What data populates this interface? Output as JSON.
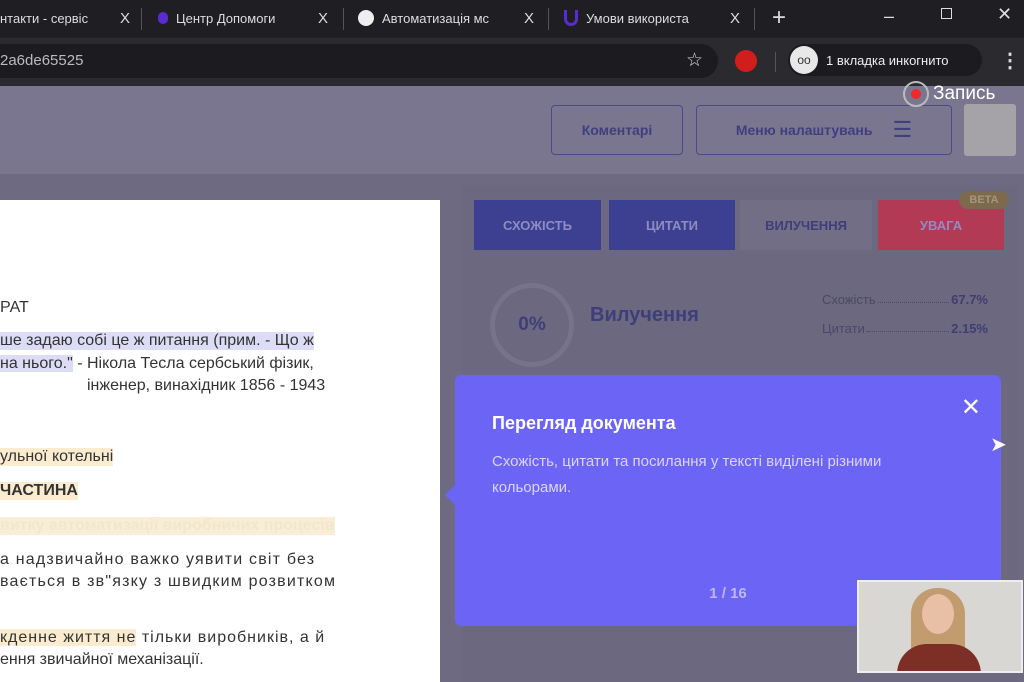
{
  "browser": {
    "tabs": [
      {
        "label": "нтакти - сервіс",
        "icon": "page-icon"
      },
      {
        "label": "Центр Допомоги",
        "icon": "unicheck-icon"
      },
      {
        "label": "Автоматизація мс",
        "icon": "globe-icon"
      },
      {
        "label": "Умови використа",
        "icon": "unicheck-icon"
      }
    ],
    "close_glyph": "X",
    "new_tab": "+",
    "url": "2a6de65525",
    "incognito_label": "1 вкладка инкогнито",
    "incognito_icon": "oo",
    "recording": "Запись"
  },
  "header": {
    "comments": "Коментарі",
    "settings_menu": "Меню налаштувань"
  },
  "document": {
    "lines": [
      "РАТ",
      "ше задаю собі це ж питання (прим. - Що ж",
      "на нього.\"",
      " - Нікола Тесла сербський фізик,",
      "інженер, винахідник 1856 - 1943",
      "ульної котельні",
      "ЧАСТИНА",
      "витку автоматизації виробничих процесів",
      "а надзвичайно важко уявити світ без",
      "вається в зв\"язку з швидким розвитком",
      "кденне життя не",
      " тільки виробників, а й",
      "ення звичайної механізації."
    ]
  },
  "report": {
    "tabs": [
      "СХОЖІСТЬ",
      "ЦИТАТИ",
      "ВИЛУЧЕННЯ",
      "УВАГА"
    ],
    "beta": "BETA",
    "percent": "0%",
    "section": "Вилучення",
    "stats": [
      {
        "label": "Схожість",
        "value": "67.7%"
      },
      {
        "label": "Цитати",
        "value": "2.15%"
      }
    ],
    "colors": {
      "similarity": "#3d3f91",
      "quotes": "#3d3f91",
      "warning": "#b23a55"
    }
  },
  "popover": {
    "title": "Перегляд документа",
    "description": "Схожість, цитати та посилання у тексті виділені різними кольорами.",
    "close": "✕",
    "pagination": "1 / 16",
    "color": "#6b64f4"
  }
}
